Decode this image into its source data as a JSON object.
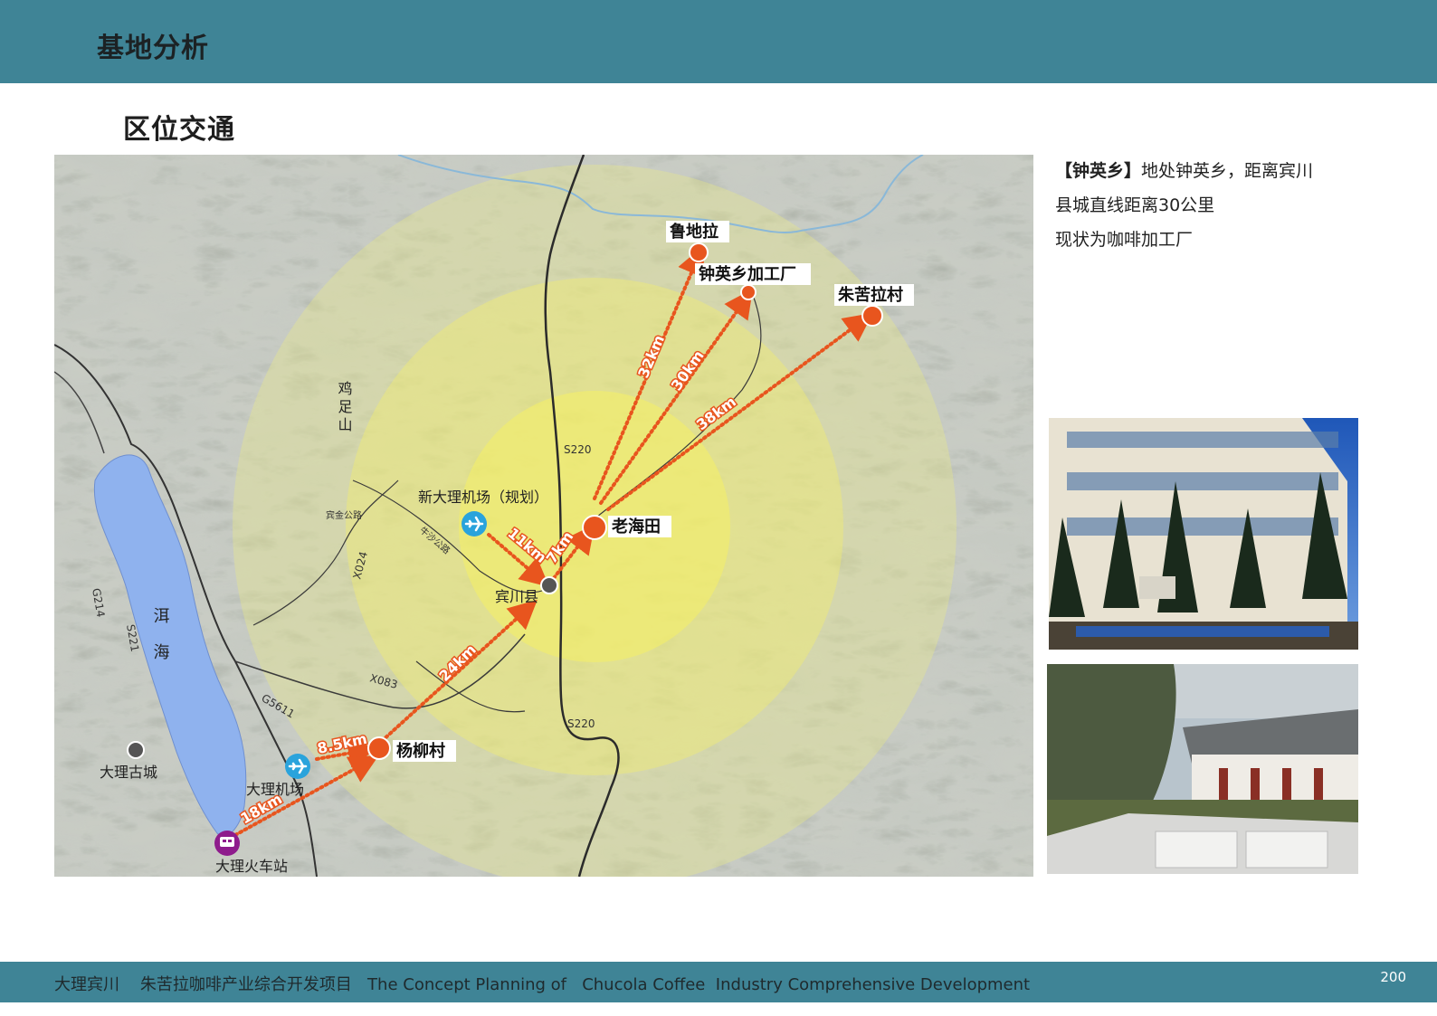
{
  "header": {
    "title": "基地分析"
  },
  "section": {
    "title": "区位交通"
  },
  "description": {
    "bracket": "【钟英乡】",
    "line1_rest": "地处钟英乡，距离宾川",
    "line2": "县城直线距离30公里",
    "line3": "现状为咖啡加工厂"
  },
  "map": {
    "places": {
      "ludila": "鲁地拉",
      "zhongying_factory": "钟英乡加工厂",
      "zhukulacun": "朱苦拉村",
      "laohaitian": "老海田",
      "binchuan": "宾川县",
      "new_airport": "新大理机场（规划）",
      "yangliucun": "杨柳村",
      "dali_airport": "大理机场",
      "dali_oldtown": "大理古城",
      "dali_station": "大理火车站",
      "jizushan": "鸡足山",
      "erhai": "洱海"
    },
    "roads": {
      "s220_a": "S220",
      "s220_b": "S220",
      "x024": "X024",
      "x083": "X083",
      "g5611": "G5611",
      "g214": "G214",
      "s221": "S221",
      "road_a": "宾金公路",
      "road_b": "牛沙公路"
    },
    "distances": {
      "d32": "32km",
      "d30": "30km",
      "d38": "38km",
      "d11": "11km",
      "d7": "7km",
      "d24": "24km",
      "d8_5": "8.5km",
      "d18": "18km"
    },
    "colors": {
      "route": "#e8551e",
      "place_marker": "#e8551e",
      "airport": "#2aa3dc",
      "station": "#8e1c8c",
      "lake": "#8fb2ee",
      "ring": "#f4f06a"
    },
    "icons": {
      "airport": "airplane-icon",
      "station": "train-icon"
    }
  },
  "footer": {
    "text": "大理宾川    朱苦拉咖啡产业综合开发项目   The Concept Planning of   Chucola Coffee  Industry Comprehensive Development",
    "page": "200"
  }
}
